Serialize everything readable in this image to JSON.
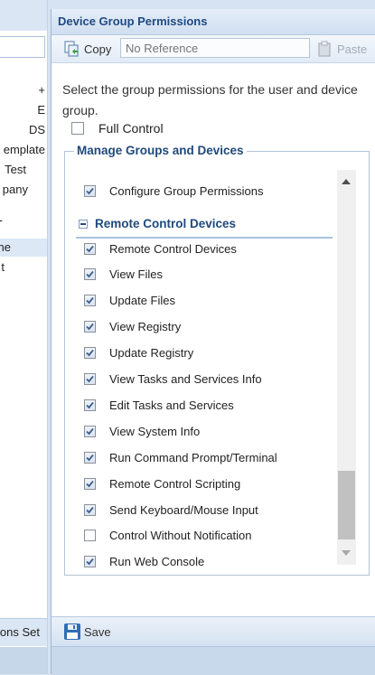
{
  "background_panel": {
    "tree_items": [
      "+",
      "E",
      "DS",
      "emplate",
      "Test",
      "pany",
      "-",
      "ne",
      "t"
    ],
    "bottom_label": "ons Set"
  },
  "dialog": {
    "title": "Device Group Permissions",
    "toolbar": {
      "copy_label": "Copy",
      "reference_placeholder": "No Reference",
      "paste_label": "Paste"
    },
    "description": "Select the group permissions for the user and device group.",
    "full_control": {
      "label": "Full Control",
      "checked": false
    },
    "fieldset_legend": "Manage Groups and Devices",
    "manage_items": [
      {
        "label": "Configure Group Permissions",
        "checked": true
      }
    ],
    "remote_section": {
      "title": "Remote Control Devices",
      "items": [
        {
          "label": "Remote Control Devices",
          "checked": true
        },
        {
          "label": "View Files",
          "checked": true
        },
        {
          "label": "Update Files",
          "checked": true
        },
        {
          "label": "View Registry",
          "checked": true
        },
        {
          "label": "Update Registry",
          "checked": true
        },
        {
          "label": "View Tasks and Services Info",
          "checked": true
        },
        {
          "label": "Edit Tasks and Services",
          "checked": true
        },
        {
          "label": "View System Info",
          "checked": true
        },
        {
          "label": "Run Command Prompt/Terminal",
          "checked": true
        },
        {
          "label": "Remote Control Scripting",
          "checked": true
        },
        {
          "label": "Send Keyboard/Mouse Input",
          "checked": true
        },
        {
          "label": "Control Without Notification",
          "checked": false
        },
        {
          "label": "Run Web Console",
          "checked": true
        }
      ]
    },
    "save_label": "Save"
  },
  "icons": [
    "copy-icon",
    "paste-icon",
    "save-icon",
    "collapse-icon",
    "checkmark-icon"
  ]
}
